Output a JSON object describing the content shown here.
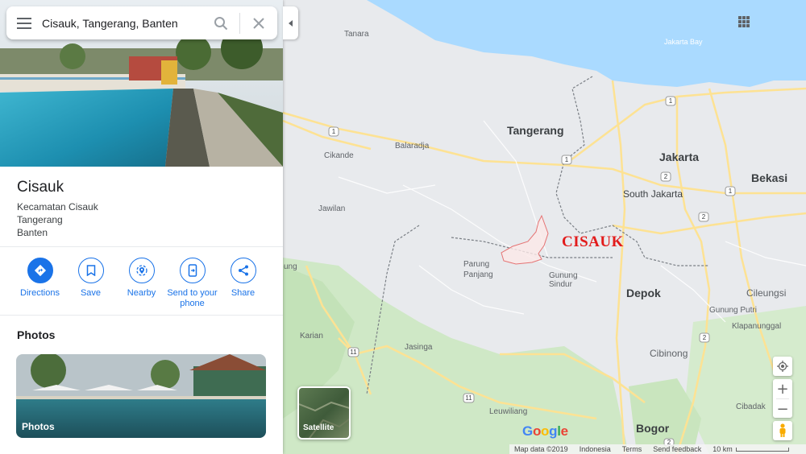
{
  "search": {
    "value": "Cisauk, Tangerang, Banten"
  },
  "place": {
    "title": "Cisauk",
    "address": [
      "Kecamatan Cisauk",
      "Tangerang",
      "Banten"
    ]
  },
  "actions": [
    {
      "label": "Directions",
      "icon": "directions-icon"
    },
    {
      "label": "Save",
      "icon": "bookmark-icon"
    },
    {
      "label": "Nearby",
      "icon": "nearby-icon"
    },
    {
      "label": "Send to your phone",
      "icon": "send-to-phone-icon"
    },
    {
      "label": "Share",
      "icon": "share-icon"
    }
  ],
  "photos": {
    "heading": "Photos",
    "card_label": "Photos"
  },
  "map": {
    "annotation": "CISAUK",
    "labels": {
      "tanara": "Tanara",
      "jakarta_bay": "Jakarta Bay",
      "tangerang": "Tangerang",
      "cikande": "Cikande",
      "balaradja": "Balaradja",
      "jakarta": "Jakarta",
      "bekasi": "Bekasi",
      "south_jakarta": "South Jakarta",
      "jawilan": "Jawilan",
      "parung_panjang": "Parung Panjang",
      "gunung_sindur": "Gunung Sindur",
      "depok": "Depok",
      "cileungsi": "Cileungsi",
      "gunung_putri": "Gunung Putri",
      "klapanunggal": "Klapanunggal",
      "karian": "Karian",
      "jasinga": "Jasinga",
      "cibinong": "Cibinong",
      "cibadak": "Cibadak",
      "leuwiliang": "Leuwiliang",
      "bogor": "Bogor",
      "ung": "ung"
    },
    "satellite_label": "Satellite",
    "footer": {
      "map_data": "Map data ©2019",
      "country": "Indonesia",
      "terms": "Terms",
      "feedback": "Send feedback",
      "scale": "10 km"
    },
    "zoom_in": "+",
    "zoom_out": "−",
    "logo": "Google"
  },
  "colors": {
    "accent": "#1a73e8",
    "water": "#aadaff",
    "road": "#fde293",
    "land": "#e8eaed",
    "forest": "#c8e6c0",
    "annotation": "#e21b1b"
  }
}
